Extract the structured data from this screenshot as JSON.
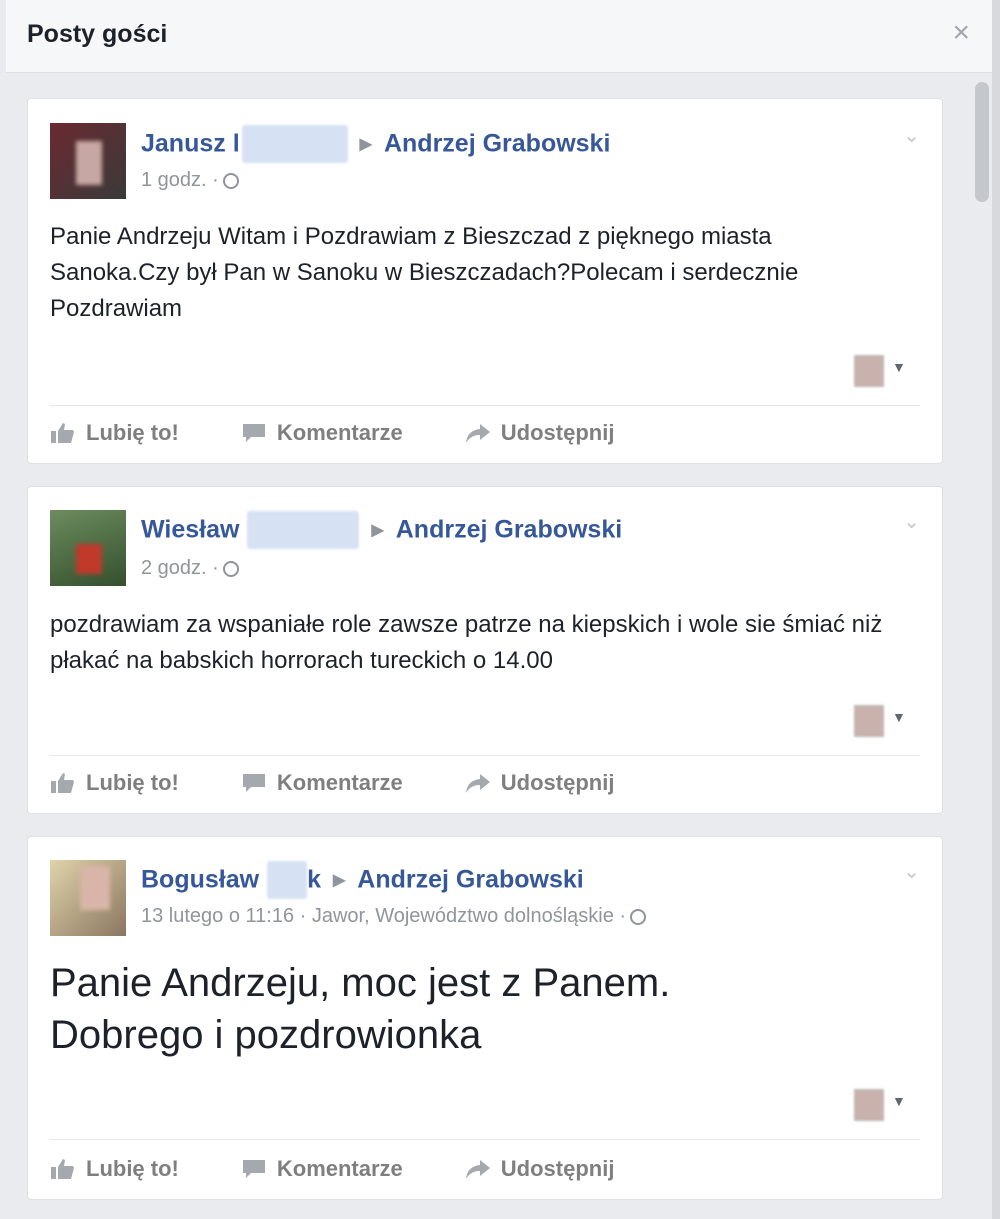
{
  "dialog": {
    "title": "Posty gości",
    "close_glyph": "×"
  },
  "posts": [
    {
      "author_first": "Janusz l",
      "target": "Andrzej Grabowski",
      "meta": "1 godz. ·",
      "text": "Panie Andrzeju Witam i Pozdrawiam z Bieszczad z pięknego miasta Sanoka.Czy był Pan w Sanoku w Bieszczadach?Polecam i serdecznie Pozdrawiam",
      "avatar_colors": [
        "#6a2a30",
        "#3a3a3a"
      ]
    },
    {
      "author_first": "Wiesław",
      "target": "Andrzej Grabowski",
      "meta": "2 godz. ·",
      "text": "pozdrawiam za wspaniałe role zawsze patrze na kiepskich i wole sie śmiać niż płakać na babskich horrorach tureckich o 14.00",
      "avatar_colors": [
        "#4d6a45",
        "#c0392b"
      ]
    },
    {
      "author_first": "Bogusław",
      "author_tail": "k",
      "target": "Andrzej Grabowski",
      "meta": "13 lutego o 11:16 · Jawor, Województwo dolnośląskie ·",
      "text": "Panie Andrzeju, moc jest z Panem. Dobrego i pozdrowionka",
      "avatar_colors": [
        "#d9c9a0",
        "#7a6a55"
      ]
    }
  ],
  "actions": {
    "like": "Lubię to!",
    "comment": "Komentarze",
    "share": "Udostępnij"
  },
  "icons": {
    "close": "close-icon",
    "like": "thumbs-up-icon",
    "comment": "comment-icon",
    "share": "share-arrow-icon",
    "privacy": "globe-icon",
    "menu": "chevron-down-icon",
    "arrow": "triangle-right-icon"
  }
}
